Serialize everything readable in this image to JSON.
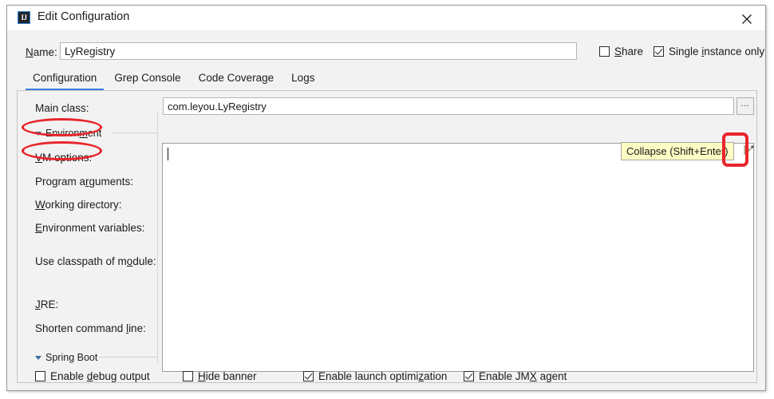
{
  "window": {
    "title": "Edit Configuration",
    "icon": "intellij-idea-icon",
    "close_icon": "close-icon"
  },
  "name_row": {
    "label": "Name:",
    "label_mnemonic": "N",
    "value": "LyRegistry",
    "share": {
      "label": "Share",
      "mnemonic": "S",
      "checked": false
    },
    "single_instance": {
      "label": "Single instance only",
      "mnemonic": "i",
      "checked": true
    }
  },
  "tabs": [
    {
      "label": "Configuration",
      "active": true
    },
    {
      "label": "Grep Console",
      "active": false
    },
    {
      "label": "Code Coverage",
      "active": false
    },
    {
      "label": "Logs",
      "active": false
    }
  ],
  "main": {
    "main_class_label": "Main class:",
    "main_class_value": "com.leyou.LyRegistry",
    "browse_button": "...",
    "environment_section": "Environment",
    "spring_boot_section": "Spring Boot",
    "labels": {
      "vm_options": "VM options:",
      "program_arguments": "Program arguments:",
      "working_directory": "Working directory:",
      "environment_variables": "Environment variables:",
      "use_classpath_of_module": "Use classpath of module:",
      "jre": "JRE:",
      "shorten_command_line": "Shorten command line:"
    },
    "vm_options_value": "",
    "collapse_icon": "collapse-arrow-icon",
    "tooltip": "Collapse (Shift+Enter)"
  },
  "bottom_checkboxes": [
    {
      "label": "Enable debug output",
      "mnemonic": "d",
      "checked": false
    },
    {
      "label": "Hide banner",
      "mnemonic": "H",
      "checked": false
    },
    {
      "label": "Enable launch optimization",
      "mnemonic": "z",
      "checked": true
    },
    {
      "label": "Enable JMX agent",
      "mnemonic": "X",
      "checked": true
    }
  ],
  "colors": {
    "annotation_red": "#e8252a",
    "tab_accent": "#3b7ddd",
    "tooltip_bg": "#fcfcc4",
    "panel_bg": "#f2f2f2"
  }
}
